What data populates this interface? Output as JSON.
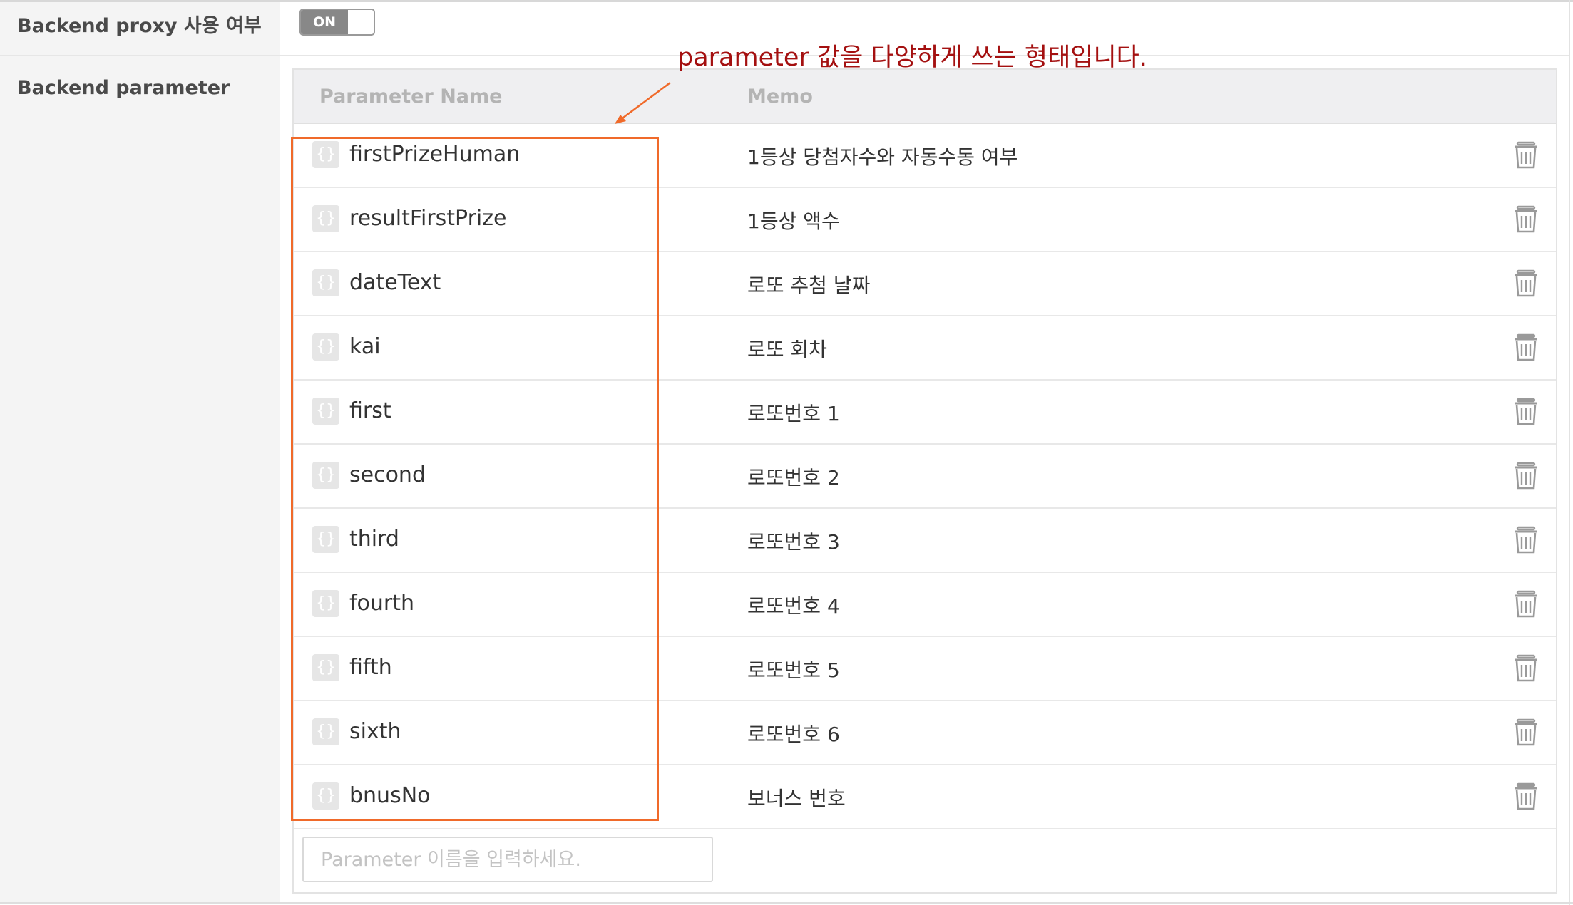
{
  "proxy_row": {
    "label": "Backend proxy 사용 여부",
    "toggle_label": "ON"
  },
  "param_row": {
    "label": "Backend parameter"
  },
  "annotation": "parameter 값을 다양하게 쓰는 형태입니다.",
  "table": {
    "header_name": "Parameter Name",
    "header_memo": "Memo",
    "rows": [
      {
        "name": "firstPrizeHuman",
        "memo": "1등상 당첨자수와 자동수동 여부"
      },
      {
        "name": "resultFirstPrize",
        "memo": "1등상 액수"
      },
      {
        "name": "dateText",
        "memo": "로또 추첨 날짜"
      },
      {
        "name": "kai",
        "memo": "로또 회차"
      },
      {
        "name": "first",
        "memo": "로또번호 1"
      },
      {
        "name": "second",
        "memo": "로또번호 2"
      },
      {
        "name": "third",
        "memo": "로또번호 3"
      },
      {
        "name": "fourth",
        "memo": "로또번호 4"
      },
      {
        "name": "fifth",
        "memo": "로또번호 5"
      },
      {
        "name": "sixth",
        "memo": "로또번호 6"
      },
      {
        "name": "bnusNo",
        "memo": "보너스 번호"
      }
    ],
    "badge_glyph": "{}",
    "row_action_icon": "trash-icon",
    "new_param_placeholder": "Parameter 이름을 입력하세요."
  },
  "colors": {
    "annotation_text": "#a41010",
    "highlight_box": "#f06a2a",
    "toggle_on": "#888888",
    "label_column_bg": "#f4f4f4",
    "table_header_bg": "#efeff1"
  }
}
